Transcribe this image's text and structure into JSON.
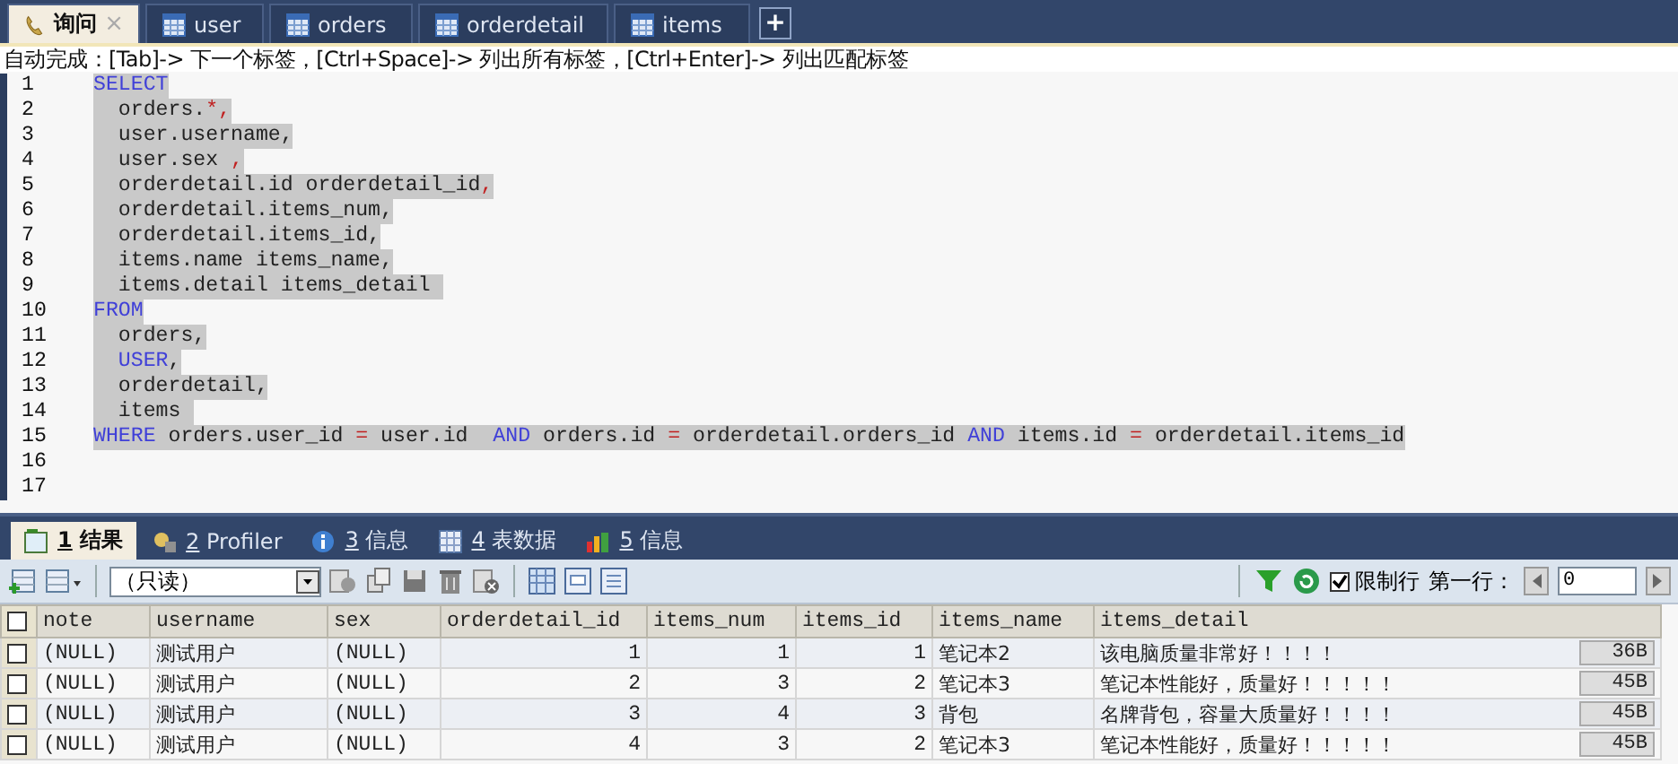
{
  "query_tabs": [
    {
      "label": "询问",
      "kind": "query",
      "selected": true,
      "close": "×"
    },
    {
      "label": "user",
      "kind": "table",
      "selected": false
    },
    {
      "label": "orders",
      "kind": "table",
      "selected": false
    },
    {
      "label": "orderdetail",
      "kind": "table",
      "selected": false
    },
    {
      "label": "items",
      "kind": "table",
      "selected": false
    }
  ],
  "add_tab": "+",
  "hint": "自动完成：[Tab]-> 下一个标签，[Ctrl+Space]-> 列出所有标签，[Ctrl+Enter]-> 列出匹配标签",
  "editor": {
    "lines": [
      {
        "number": "1",
        "selected": true,
        "tokens": [
          {
            "text": "SELECT",
            "kind": "keyword"
          }
        ]
      },
      {
        "number": "2",
        "selected": true,
        "tokens": [
          {
            "text": "  orders.",
            "kind": "plain"
          },
          {
            "text": "*,",
            "kind": "operator"
          }
        ]
      },
      {
        "number": "3",
        "selected": true,
        "tokens": [
          {
            "text": "  user.username,",
            "kind": "plain"
          }
        ]
      },
      {
        "number": "4",
        "selected": true,
        "tokens": [
          {
            "text": "  user.sex ",
            "kind": "plain"
          },
          {
            "text": ",",
            "kind": "operator"
          }
        ]
      },
      {
        "number": "5",
        "selected": true,
        "tokens": [
          {
            "text": "  orderdetail.id orderdetail_id",
            "kind": "plain"
          },
          {
            "text": ",",
            "kind": "operator"
          }
        ]
      },
      {
        "number": "6",
        "selected": true,
        "tokens": [
          {
            "text": "  orderdetail.items_num,",
            "kind": "plain"
          }
        ]
      },
      {
        "number": "7",
        "selected": true,
        "tokens": [
          {
            "text": "  orderdetail.items_id,",
            "kind": "plain"
          }
        ]
      },
      {
        "number": "8",
        "selected": true,
        "tokens": [
          {
            "text": "  items.name items_name,",
            "kind": "plain"
          }
        ]
      },
      {
        "number": "9",
        "selected": true,
        "tokens": [
          {
            "text": "  items.detail items_detail ",
            "kind": "plain"
          }
        ]
      },
      {
        "number": "10",
        "selected": true,
        "tokens": [
          {
            "text": "FROM",
            "kind": "keyword"
          }
        ]
      },
      {
        "number": "11",
        "selected": true,
        "tokens": [
          {
            "text": "  orders,",
            "kind": "plain"
          }
        ]
      },
      {
        "number": "12",
        "selected": true,
        "tokens": [
          {
            "text": "  USER",
            "kind": "keyword"
          },
          {
            "text": ",",
            "kind": "plain"
          }
        ]
      },
      {
        "number": "13",
        "selected": true,
        "tokens": [
          {
            "text": "  orderdetail,",
            "kind": "plain"
          }
        ]
      },
      {
        "number": "14",
        "selected": true,
        "tokens": [
          {
            "text": "  items ",
            "kind": "plain"
          }
        ]
      },
      {
        "number": "15",
        "selected": true,
        "tokens": [
          {
            "text": "WHERE",
            "kind": "keyword"
          },
          {
            "text": " orders.user_id ",
            "kind": "plain"
          },
          {
            "text": "=",
            "kind": "operator"
          },
          {
            "text": " user.id  ",
            "kind": "plain"
          },
          {
            "text": "AND",
            "kind": "keyword"
          },
          {
            "text": " orders.id ",
            "kind": "plain"
          },
          {
            "text": "=",
            "kind": "operator"
          },
          {
            "text": " orderdetail.orders_id ",
            "kind": "plain"
          },
          {
            "text": "AND",
            "kind": "keyword"
          },
          {
            "text": " items.id ",
            "kind": "plain"
          },
          {
            "text": "=",
            "kind": "operator"
          },
          {
            "text": " orderdetail.items_id",
            "kind": "plain"
          }
        ]
      },
      {
        "number": "16",
        "selected": false
      },
      {
        "number": "17",
        "selected": false
      }
    ]
  },
  "results": {
    "tabs": [
      {
        "number": "1",
        "label": "结果",
        "kind": "result",
        "selected": true
      },
      {
        "number": "2",
        "label": "Profiler",
        "kind": "profiler",
        "selected": false
      },
      {
        "number": "3",
        "label": "信息",
        "kind": "info",
        "selected": false
      },
      {
        "number": "4",
        "label": "表数据",
        "kind": "tabledata",
        "selected": false
      },
      {
        "number": "5",
        "label": "信息",
        "kind": "info2",
        "selected": false
      }
    ],
    "toolbar": {
      "mode": "（只读）",
      "limit_rows": {
        "label": "限制行",
        "checked": true
      },
      "first_row_label": "第一行：",
      "first_row": "0"
    },
    "table": {
      "select_all": {
        "checked": false
      },
      "columns": [
        {
          "label": "note",
          "kind": "text"
        },
        {
          "label": "username",
          "kind": "text"
        },
        {
          "label": "sex",
          "kind": "text"
        },
        {
          "label": "orderdetail_id",
          "kind": "number"
        },
        {
          "label": "items_num",
          "kind": "number"
        },
        {
          "label": "items_id",
          "kind": "number"
        },
        {
          "label": "items_name",
          "kind": "text"
        },
        {
          "label": "items_detail",
          "kind": "text"
        }
      ],
      "rows": [
        {
          "checked": false,
          "cells": [
            "(NULL)",
            "测试用户",
            "(NULL)",
            "1",
            "1",
            "1",
            "笔记本2",
            "该电脑质量非常好！！！！"
          ],
          "blob": "36B"
        },
        {
          "checked": false,
          "cells": [
            "(NULL)",
            "测试用户",
            "(NULL)",
            "2",
            "3",
            "2",
            "笔记本3",
            "笔记本性能好，质量好！！！！！"
          ],
          "blob": "45B"
        },
        {
          "checked": false,
          "cells": [
            "(NULL)",
            "测试用户",
            "(NULL)",
            "3",
            "4",
            "3",
            "背包",
            "名牌背包，容量大质量好！！！！"
          ],
          "blob": "45B"
        },
        {
          "checked": false,
          "cells": [
            "(NULL)",
            "测试用户",
            "(NULL)",
            "4",
            "3",
            "2",
            "笔记本3",
            "笔记本性能好，质量好！！！！！"
          ],
          "blob": "45B"
        }
      ]
    }
  }
}
